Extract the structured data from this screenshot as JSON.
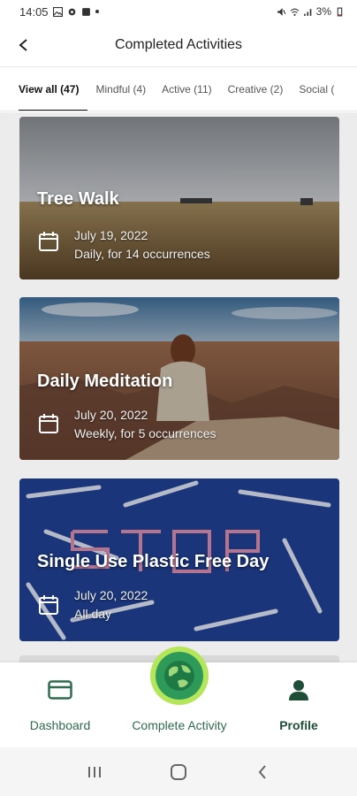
{
  "status": {
    "time": "14:05",
    "battery": "3%"
  },
  "header": {
    "title": "Completed Activities"
  },
  "tabs": [
    {
      "label": "View all (47)"
    },
    {
      "label": "Mindful (4)"
    },
    {
      "label": "Active (11)"
    },
    {
      "label": "Creative (2)"
    },
    {
      "label": "Social ("
    }
  ],
  "activities": [
    {
      "title": "Tree Walk",
      "date": "July 19, 2022",
      "frequency": "Daily, for 14 occurrences"
    },
    {
      "title": "Daily Meditation",
      "date": "July 20, 2022",
      "frequency": "Weekly, for 5 occurrences"
    },
    {
      "title": "Single Use Plastic Free Day",
      "date": "July 20, 2022",
      "frequency": "All day"
    }
  ],
  "nav": {
    "dashboard": "Dashboard",
    "complete": "Complete Activity",
    "profile": "Profile"
  },
  "colors": {
    "accent": "#2f6b4f",
    "fab_ring": "#b5e65a",
    "fab_fill": "#2e9a5a"
  }
}
